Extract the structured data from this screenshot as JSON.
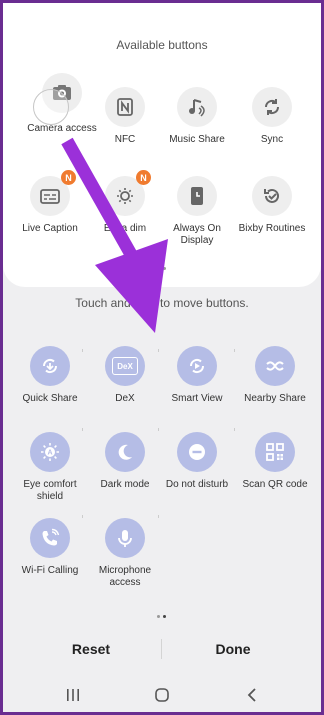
{
  "available": {
    "title": "Available buttons",
    "buttons": [
      {
        "label": "Camera access",
        "icon": "camera-icon"
      },
      {
        "label": "NFC",
        "icon": "nfc-icon"
      },
      {
        "label": "Music Share",
        "icon": "music-share-icon"
      },
      {
        "label": "Sync",
        "icon": "sync-icon"
      },
      {
        "label": "Live Caption",
        "icon": "live-caption-icon",
        "badge": "N"
      },
      {
        "label": "Extra dim",
        "icon": "extra-dim-icon",
        "badge": "N"
      },
      {
        "label": "Always On Display",
        "icon": "always-on-display-icon"
      },
      {
        "label": "Bixby Routines",
        "icon": "bixby-routines-icon"
      }
    ]
  },
  "hint": "Touch and hold to move buttons.",
  "active": {
    "buttons": [
      {
        "label": "Quick Share",
        "icon": "quick-share-icon"
      },
      {
        "label": "DeX",
        "icon": "dex-icon",
        "icon_text": "DeX"
      },
      {
        "label": "Smart View",
        "icon": "smart-view-icon"
      },
      {
        "label": "Nearby Share",
        "icon": "nearby-share-icon"
      },
      {
        "label": "Eye comfort shield",
        "icon": "eye-comfort-shield-icon"
      },
      {
        "label": "Dark mode",
        "icon": "dark-mode-icon"
      },
      {
        "label": "Do not disturb",
        "icon": "do-not-disturb-icon"
      },
      {
        "label": "Scan QR code",
        "icon": "scan-qr-code-icon"
      },
      {
        "label": "Wi-Fi Calling",
        "icon": "wifi-calling-icon"
      },
      {
        "label": "Microphone access",
        "icon": "microphone-icon"
      }
    ]
  },
  "actions": {
    "reset": "Reset",
    "done": "Done"
  },
  "navbar": {
    "recent": "recent-apps-icon",
    "home": "home-icon",
    "back": "back-icon"
  },
  "colors": {
    "arrow": "#9b30d9",
    "border": "#6a2d91",
    "active_icon_bg": "#b5bde6",
    "badge": "#f07b2f"
  }
}
